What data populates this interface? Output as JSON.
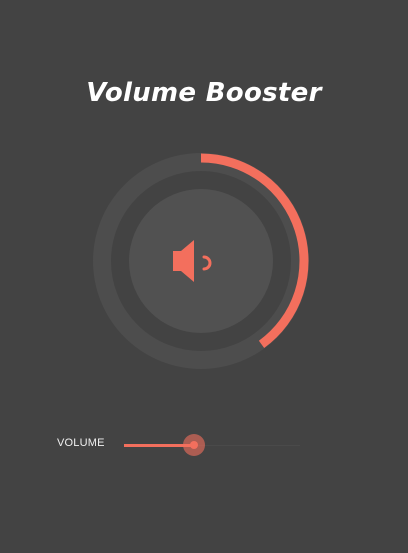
{
  "app": {
    "title": "Volume Booster"
  },
  "booster": {
    "level": 0.4,
    "icon": "speaker-icon",
    "colors": {
      "accent": "#f36f5d",
      "background": "#434343",
      "ring_track": "#4d4d4d",
      "inner_disc": "#515151"
    }
  },
  "volume": {
    "label": "VOLUME",
    "level": 0.4
  }
}
